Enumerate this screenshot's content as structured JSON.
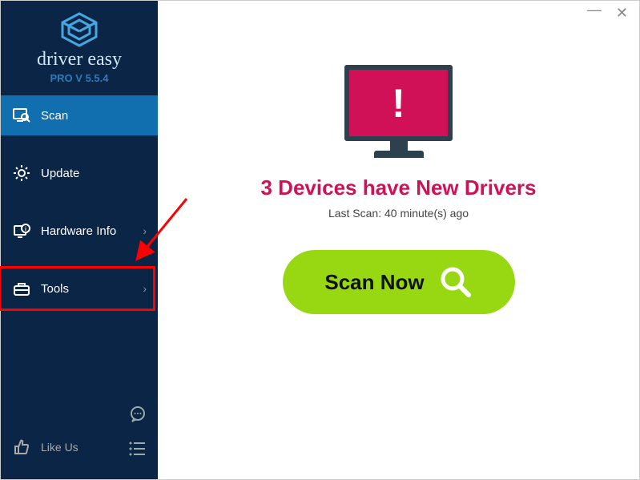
{
  "app": {
    "name": "driver easy",
    "version_label": "PRO V 5.5.4"
  },
  "sidebar": {
    "items": [
      {
        "label": "Scan",
        "icon": "search-monitor-icon",
        "has_chevron": false
      },
      {
        "label": "Update",
        "icon": "gear-icon",
        "has_chevron": false
      },
      {
        "label": "Hardware Info",
        "icon": "info-badge-icon",
        "has_chevron": true
      },
      {
        "label": "Tools",
        "icon": "toolbox-icon",
        "has_chevron": true
      }
    ],
    "like_label": "Like Us"
  },
  "main": {
    "headline": "3 Devices have New Drivers",
    "subtext": "Last Scan: 40 minute(s) ago",
    "scan_button_label": "Scan Now"
  },
  "colors": {
    "sidebar_bg": "#0a2545",
    "active_item": "#126faf",
    "accent_magenta": "#d01158",
    "scan_green": "#98d813",
    "monitor_frame": "#2d404e",
    "annotation_red": "#ff0000"
  }
}
